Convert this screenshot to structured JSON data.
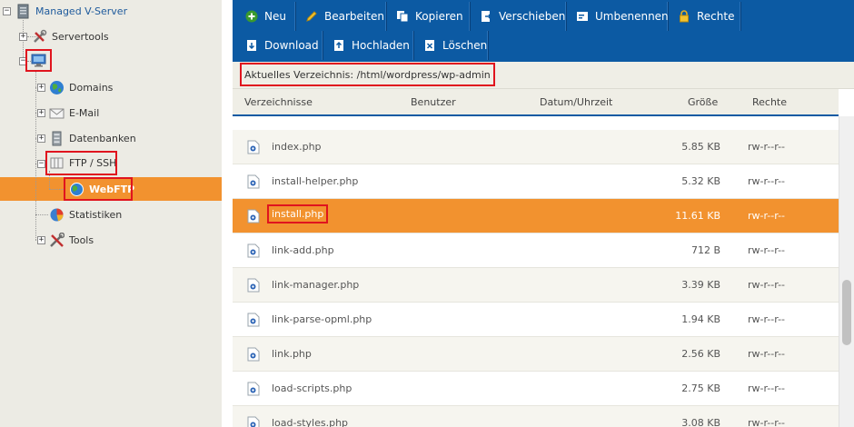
{
  "tree": {
    "root": "Managed V-Server",
    "items": [
      {
        "label": "Servertools"
      },
      {
        "label": ""
      },
      {
        "label": "Domains"
      },
      {
        "label": "E-Mail"
      },
      {
        "label": "Datenbanken"
      },
      {
        "label": "FTP / SSH"
      },
      {
        "label": "WebFTP"
      },
      {
        "label": "Statistiken"
      },
      {
        "label": "Tools"
      }
    ]
  },
  "toolbar": {
    "neu": "Neu",
    "bearbeiten": "Bearbeiten",
    "kopieren": "Kopieren",
    "verschieben": "Verschieben",
    "umbenennen": "Umbenennen",
    "rechte": "Rechte",
    "download": "Download",
    "hochladen": "Hochladen",
    "loeschen": "Löschen"
  },
  "path": {
    "label": "Aktuelles Verzeichnis:",
    "value": "/html/wordpress/wp-admin"
  },
  "columns": {
    "name": "Verzeichnisse",
    "user": "Benutzer",
    "date": "Datum/Uhrzeit",
    "size": "Größe",
    "rights": "Rechte"
  },
  "files": [
    {
      "name": "index.php",
      "size": "5.85 KB",
      "rights": "rw-r--r--"
    },
    {
      "name": "install-helper.php",
      "size": "5.32 KB",
      "rights": "rw-r--r--"
    },
    {
      "name": "install.php",
      "size": "11.61 KB",
      "rights": "rw-r--r--",
      "selected": true
    },
    {
      "name": "link-add.php",
      "size": "712 B",
      "rights": "rw-r--r--"
    },
    {
      "name": "link-manager.php",
      "size": "3.39 KB",
      "rights": "rw-r--r--"
    },
    {
      "name": "link-parse-opml.php",
      "size": "1.94 KB",
      "rights": "rw-r--r--"
    },
    {
      "name": "link.php",
      "size": "2.56 KB",
      "rights": "rw-r--r--"
    },
    {
      "name": "load-scripts.php",
      "size": "2.75 KB",
      "rights": "rw-r--r--"
    },
    {
      "name": "load-styles.php",
      "size": "3.08 KB",
      "rights": "rw-r--r--"
    }
  ],
  "colors": {
    "toolbar": "#0c5aa3",
    "selection": "#f2922f",
    "highlight": "#e0141e",
    "tree_bg": "#ecebe4"
  }
}
